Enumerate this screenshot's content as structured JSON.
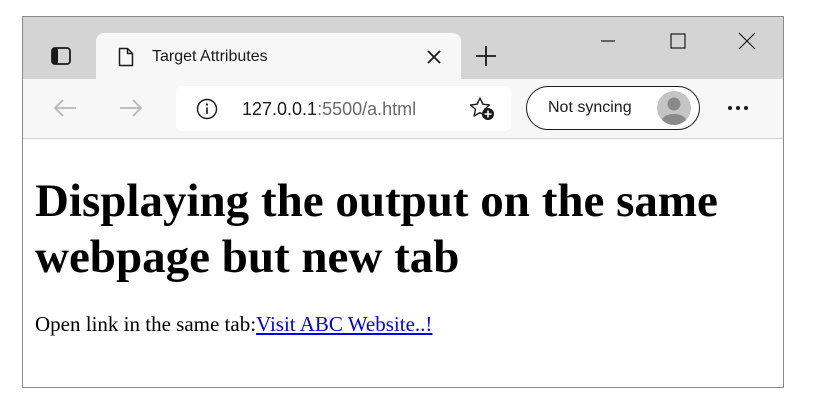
{
  "tab": {
    "title": "Target Attributes"
  },
  "address_bar": {
    "url_host": "127.0.0.1",
    "url_rest": ":5500/a.html"
  },
  "profile": {
    "sync_label": "Not syncing"
  },
  "page": {
    "heading": "Displaying the output on the same webpage but new tab",
    "paragraph_text": "Open link in the same tab:",
    "link_text": "Visit ABC Website..!"
  },
  "icons": [
    "tab-actions-icon",
    "page-icon",
    "close-icon",
    "plus-icon",
    "minimize-icon",
    "maximize-icon",
    "window-close-icon",
    "back-arrow-icon",
    "forward-arrow-icon",
    "info-icon",
    "add-favorite-icon",
    "avatar-icon",
    "more-icon"
  ],
  "colors": {
    "tabstrip": "#d4d4d4",
    "toolbar": "#f7f7f7",
    "link": "#0000ee"
  }
}
